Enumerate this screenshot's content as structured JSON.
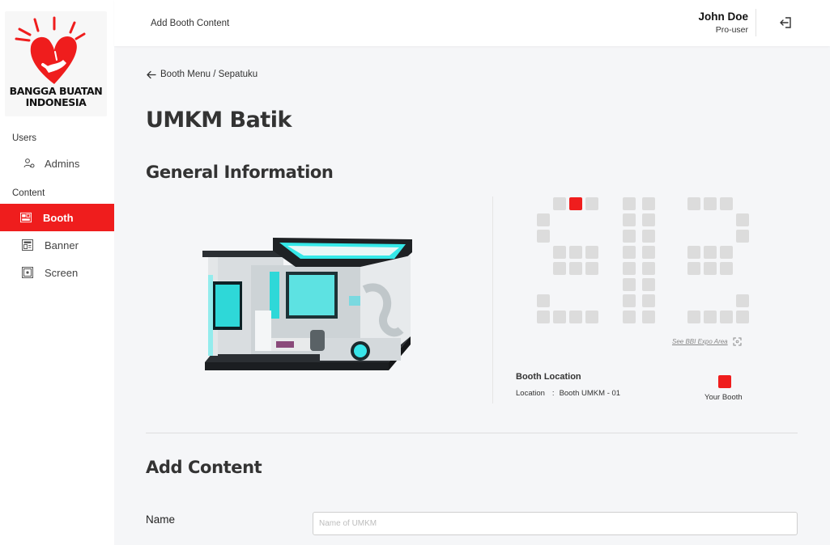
{
  "brand": {
    "logo_line1": "BANGGA BUATAN",
    "logo_line2": "INDONESIA",
    "logo_color": "#ef1d1d"
  },
  "sidebar": {
    "section_users": "Users",
    "admins_label": "Admins",
    "section_content": "Content",
    "items": [
      {
        "label": "Booth",
        "icon": "booth-icon",
        "active": true
      },
      {
        "label": "Banner",
        "icon": "banner-icon",
        "active": false
      },
      {
        "label": "Screen",
        "icon": "screen-icon",
        "active": false
      }
    ],
    "active_color": "#ef1d1d"
  },
  "header": {
    "title": "Add Booth Content",
    "user_name": "John Doe",
    "user_role": "Pro-user",
    "logout_icon": "logout-icon"
  },
  "main": {
    "breadcrumb": "Booth Menu / Sepatuku",
    "page_title": "UMKM Batik",
    "general_info_title": "General Information",
    "see_expo_link": "See BBI Expo Area",
    "booth_location": {
      "title": "Booth Location",
      "location_label": "Location",
      "separator": ":",
      "location_value": "Booth UMKM - 01"
    },
    "legend_label": "Your Booth",
    "add_content_title": "Add Content",
    "name_field": {
      "label": "Name",
      "value": "",
      "placeholder": "Name of UMKM"
    }
  }
}
